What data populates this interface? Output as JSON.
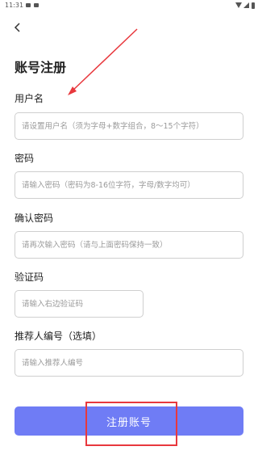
{
  "status_bar": {
    "time": "11:31",
    "icons": [
      "sim-card-icon",
      "notification-icon",
      "wifi-icon",
      "signal-icon",
      "battery-icon"
    ]
  },
  "header": {
    "back_icon": "chevron-left-icon",
    "title": "账号注册"
  },
  "form": {
    "username": {
      "label": "用户名",
      "placeholder": "请设置用户名（须为字母+数字组合，8～15个字符）",
      "value": ""
    },
    "password": {
      "label": "密码",
      "placeholder": "请输入密码（密码为8-16位字符，字母/数字均可）",
      "value": ""
    },
    "confirm_password": {
      "label": "确认密码",
      "placeholder": "请再次输入密码（请与上面密码保持一致）",
      "value": ""
    },
    "captcha": {
      "label": "验证码",
      "placeholder": "请输入右边验证码",
      "value": ""
    },
    "referrer": {
      "label": "推荐人编号（选填）",
      "placeholder": "请输入推荐人编号",
      "value": ""
    },
    "submit_label": "注册账号"
  },
  "colors": {
    "accent": "#6f7cf5",
    "annotation": "#e8383d",
    "input_border": "#cfcfcf"
  }
}
